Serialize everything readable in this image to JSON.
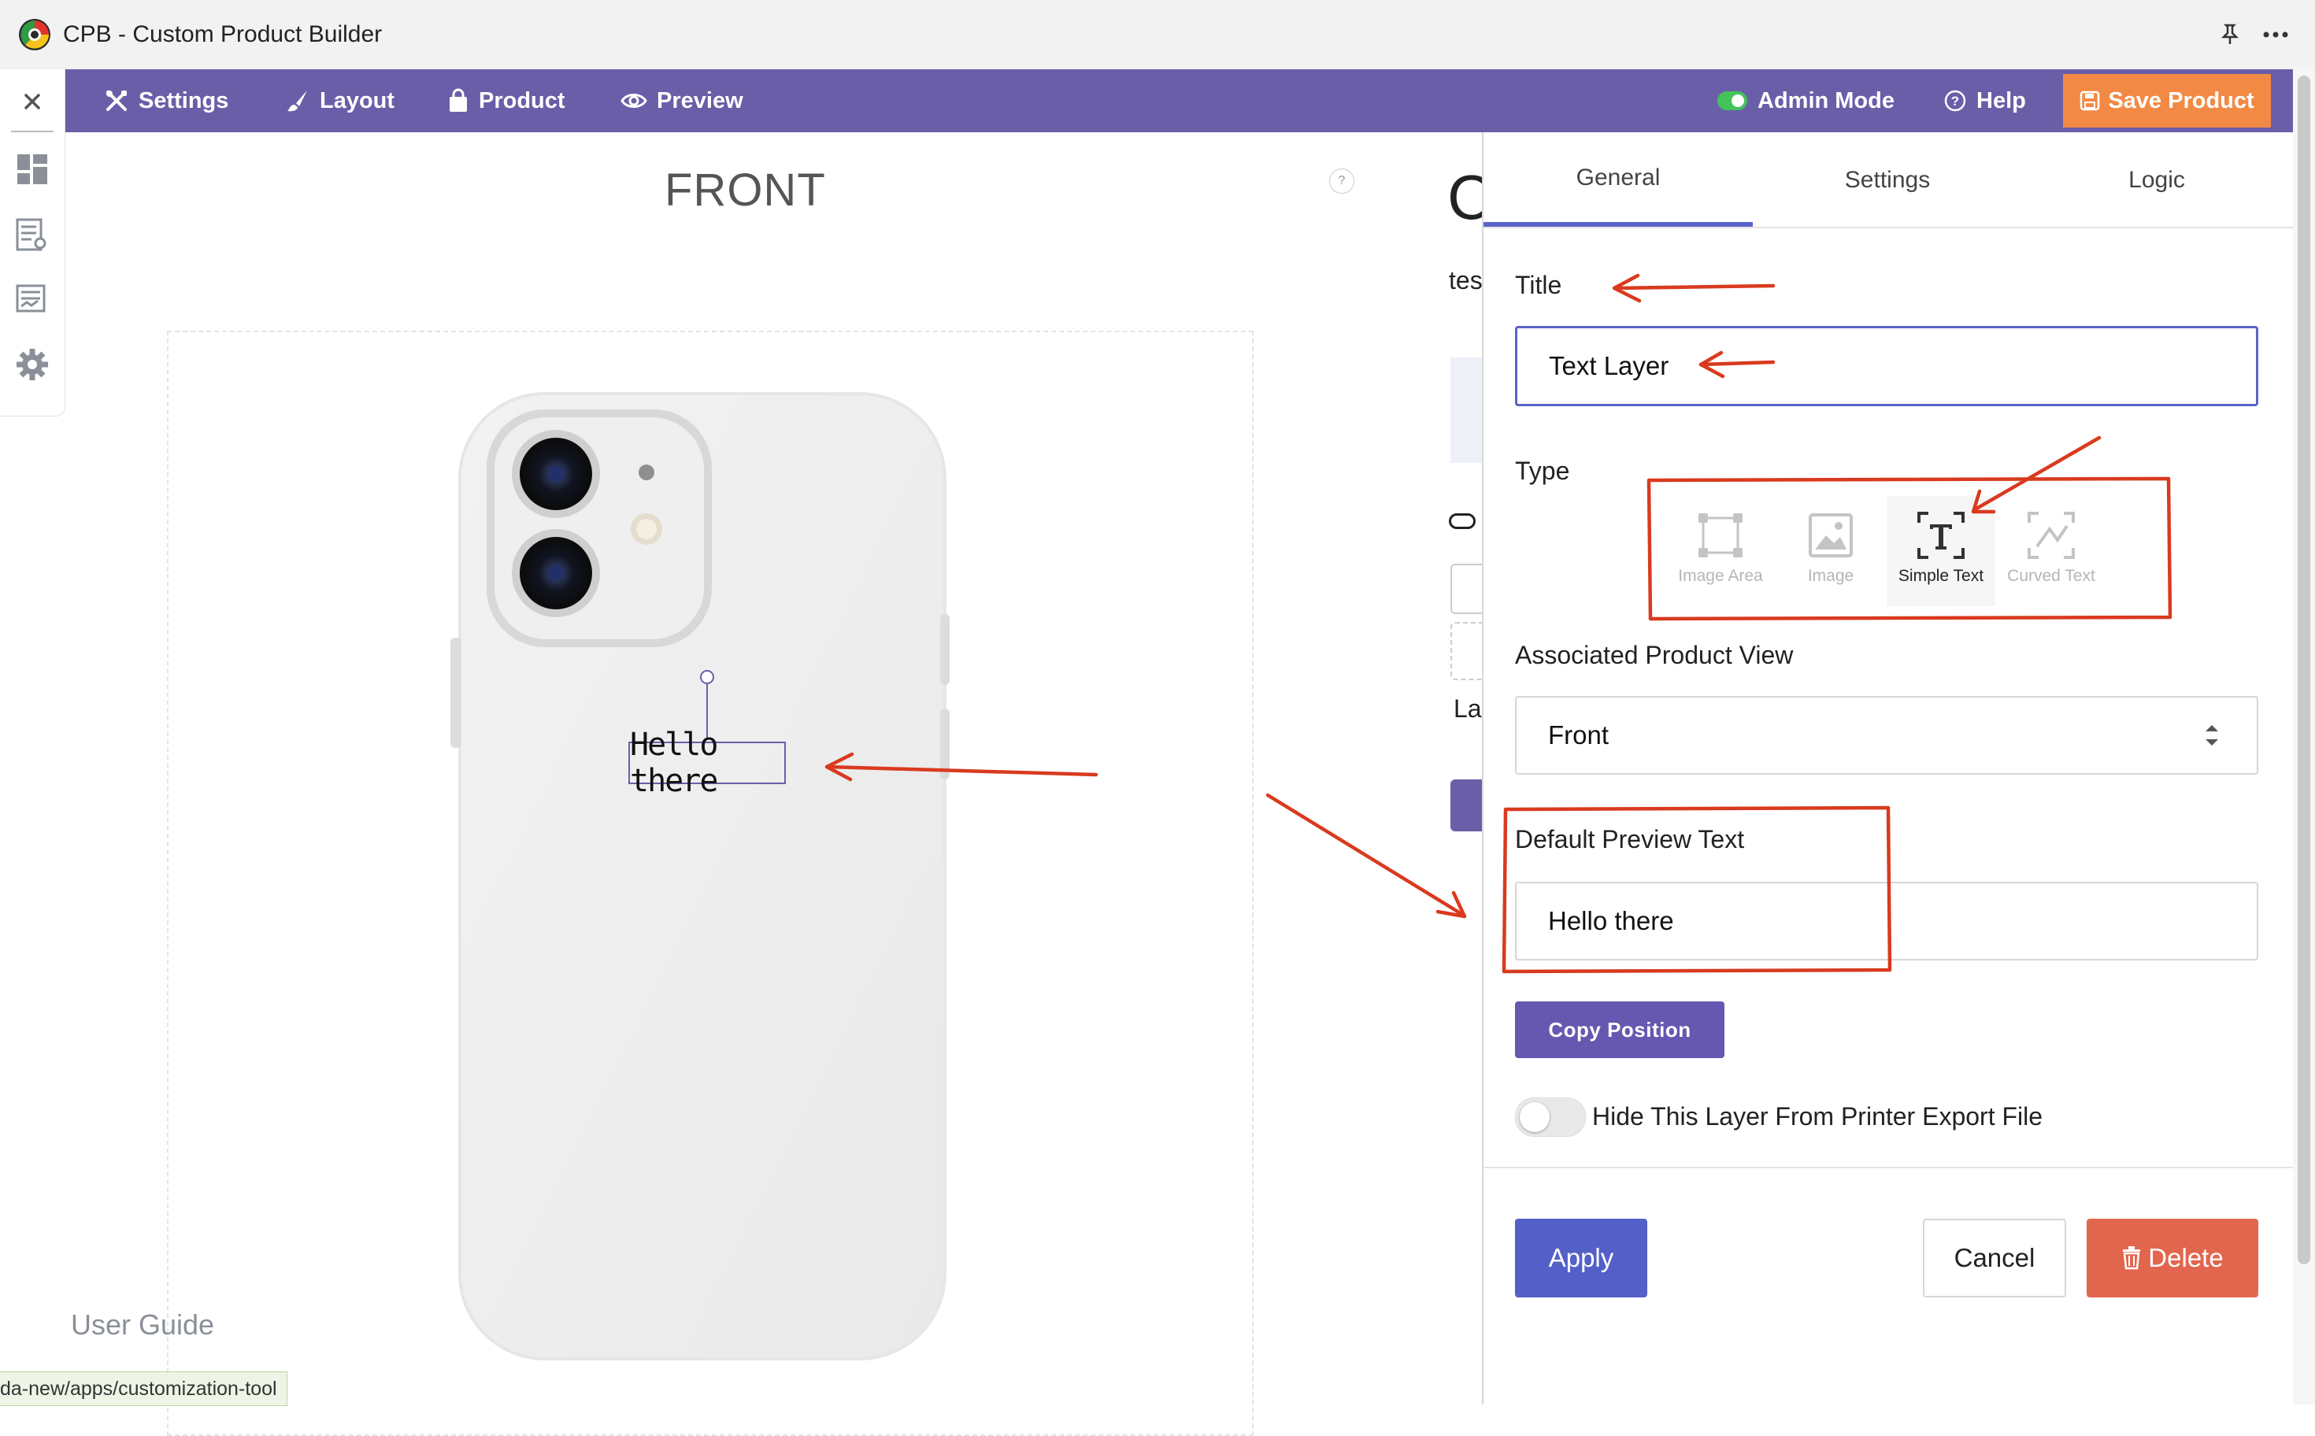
{
  "window": {
    "title": "CPB - Custom Product Builder"
  },
  "nav": {
    "settings": "Settings",
    "layout": "Layout",
    "product": "Product",
    "preview": "Preview",
    "admin_mode": "Admin Mode",
    "help": "Help",
    "save": "Save Product"
  },
  "canvas": {
    "view_title": "FRONT",
    "help_glyph": "?",
    "text_layer": "Hello there",
    "user_guide": "User Guide",
    "status_url": "da-new/apps/customization-tool"
  },
  "behind_panel": {
    "heading_glyph": "C",
    "fragment_1": "tes",
    "fragment_2": "La"
  },
  "panel": {
    "tabs": [
      "General",
      "Settings",
      "Logic"
    ],
    "title_label": "Title",
    "title_value": "Text Layer",
    "type_label": "Type",
    "type_options": [
      {
        "label": "Image Area",
        "icon": "image-area-icon",
        "selected": false
      },
      {
        "label": "Image",
        "icon": "image-icon",
        "selected": false
      },
      {
        "label": "Simple Text",
        "icon": "simple-text-icon",
        "selected": true
      },
      {
        "label": "Curved Text",
        "icon": "curved-text-icon",
        "selected": false
      }
    ],
    "view_label": "Associated Product View",
    "view_value": "Front",
    "preview_label": "Default Preview Text",
    "preview_value": "Hello there",
    "copy_position": "Copy Position",
    "hide_layer_label": "Hide This Layer From Printer Export File",
    "hide_layer_on": false,
    "apply": "Apply",
    "cancel": "Cancel",
    "delete": "Delete"
  },
  "colors": {
    "nav_bg": "#6b5ea8",
    "save_btn": "#f28a45",
    "apply_btn": "#5460c8",
    "delete_btn": "#e2664d",
    "annotation_red": "#d93a1f"
  }
}
